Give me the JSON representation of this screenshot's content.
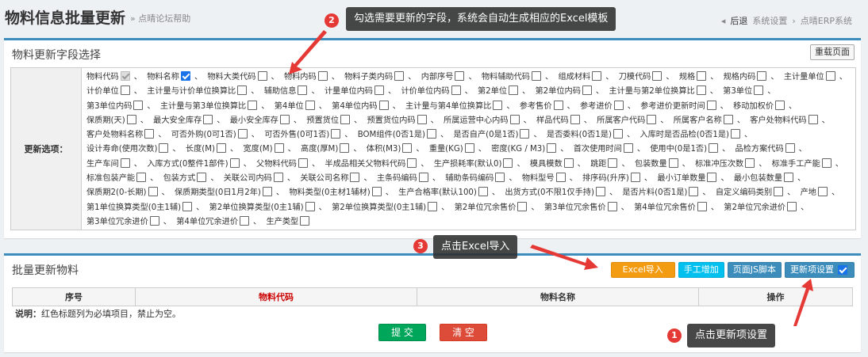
{
  "header": {
    "title": "物料信息批量更新",
    "help": "» 点晴论坛帮助",
    "back": "后退",
    "crumb1": "系统设置",
    "crumb_sep": "›",
    "crumb2": "点晴ERP系统"
  },
  "panel1": {
    "title": "物料更新字段选择",
    "reload": "重载页面",
    "label": "更新选项："
  },
  "fields": [
    "物料代码",
    "物料名称",
    "物料大类代码",
    "物料内码",
    "物料子类内码",
    "内部序号",
    "物料辅助代码",
    "组成材料",
    "刀模代码",
    "规格",
    "规格内码",
    "主计量单位",
    "计价单位",
    "主计量与计价单位换算比",
    "辅助信息",
    "计量单位内码",
    "计价单位内码",
    "第2单位",
    "第2单位内码",
    "主计量与第2单位换算比",
    "第3单位",
    "第3单位内码",
    "主计量与第3单位换算比",
    "第4单位",
    "第4单位内码",
    "主计量与第4单位换算比",
    "参考售价",
    "参考进价",
    "参考进价更新时间",
    "移动加权价",
    "保质期(天)",
    "最大安全库存",
    "最小安全库存",
    "预置货位",
    "预置货位内码",
    "所属运营中心内码",
    "样品代码",
    "所属客户代码",
    "所属客户名称",
    "客户处物料代码",
    "客户处物料名称",
    "可否外购(0可1否)",
    "可否外售(0可1否)",
    "BOM组件(0否1是)",
    "是否自产(0是1否)",
    "是否委料(0否1是)",
    "入库时是否品检(0否1是)",
    "设计寿命(使用次数)",
    "长度(M)",
    "宽度(M)",
    "高度(厚M)",
    "体积(M3)",
    "重量(KG)",
    "密度(KG / M3)",
    "首次使用时间",
    "使用中(0是1否)",
    "品检方案代码",
    "生产车间",
    "入库方式(0整件1部件)",
    "父物料代码",
    "半成品相关父物料代码",
    "生产损耗率(默认0)",
    "模具模数",
    "跳距",
    "包装数量",
    "标准冲压次数",
    "标准手工产能",
    "标准包装产能",
    "包装方式",
    "关联公司内码",
    "关联公司名称",
    "主条码编码",
    "辅助条码编码",
    "物料型号",
    "排序码(升序)",
    "最小订单数量",
    "最小包装数量",
    "保质期2(0-长期)",
    "保质期类型(0日1月2年)",
    "物料类型(0主材1辅材)",
    "生产合格率(默认100)",
    "出货方式(0不限1仅手持)",
    "是否片料(0否1是)",
    "自定义编码类别",
    "产地",
    "第1单位换算类型(0主1辅)",
    "第2单位换算类型(0主1辅)",
    "第2单位换算类型(0主1辅)",
    "第2单位冗余售价",
    "第3单位冗余售价",
    "第4单位冗余售价",
    "第2单位冗余进价",
    "第3单位冗余进价",
    "第4单位冗余进价",
    "生产类型"
  ],
  "field_states": {
    "0": "disabled",
    "1": "checked"
  },
  "field_sep": "、",
  "panel2": {
    "title": "批量更新物料",
    "excel_import": "Excel导入",
    "manual_add": "手工增加",
    "page_js": "页面JS脚本",
    "update_settings": "更新项设置",
    "columns": [
      "序号",
      "物料代码",
      "物料名称",
      "操作"
    ],
    "note_label": "说明：",
    "note_text": "红色标题列为必填项目，禁止为空。",
    "submit": "提 交",
    "clear": "清 空"
  },
  "callouts": {
    "c1": {
      "num": "1",
      "text": "点击更新项设置"
    },
    "c2": {
      "num": "2",
      "text": "勾选需要更新的字段，系统会自动生成相应的Excel模板"
    },
    "c3": {
      "num": "3",
      "text": "点击Excel导入"
    }
  },
  "colors": {
    "accent": "#3c8dbc",
    "required": "#c00000",
    "badge": "#e53935"
  }
}
